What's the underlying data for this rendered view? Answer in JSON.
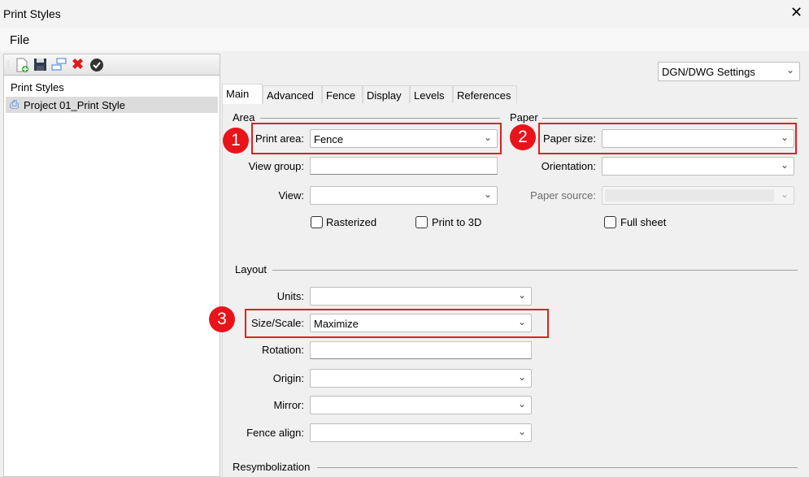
{
  "window": {
    "title": "Print Styles"
  },
  "menu": {
    "file": "File"
  },
  "toolbar": {
    "icons": [
      "new-icon",
      "save-icon",
      "copy-icon",
      "delete-icon",
      "apply-icon"
    ]
  },
  "tree": {
    "root": "Print Styles",
    "items": [
      "Project 01_Print Style"
    ]
  },
  "settings_dropdown": "DGN/DWG Settings",
  "tabs": [
    "Main",
    "Advanced",
    "Fence",
    "Display",
    "Levels",
    "References"
  ],
  "area": {
    "title": "Area",
    "print_area_label": "Print area:",
    "print_area_value": "Fence",
    "view_group_label": "View group:",
    "view_group_value": "",
    "view_label": "View:",
    "view_value": "",
    "rasterized": "Rasterized",
    "print_to_3d": "Print to 3D"
  },
  "paper": {
    "title": "Paper",
    "paper_size_label": "Paper size:",
    "paper_size_value": "",
    "orientation_label": "Orientation:",
    "orientation_value": "",
    "paper_source_label": "Paper source:",
    "full_sheet": "Full sheet"
  },
  "layout": {
    "title": "Layout",
    "units_label": "Units:",
    "units_value": "",
    "size_scale_label": "Size/Scale:",
    "size_scale_value": "Maximize",
    "rotation_label": "Rotation:",
    "rotation_value": "",
    "origin_label": "Origin:",
    "origin_value": "",
    "mirror_label": "Mirror:",
    "mirror_value": "",
    "fence_align_label": "Fence align:",
    "fence_align_value": ""
  },
  "resymbolization": {
    "title": "Resymbolization"
  },
  "annotations": [
    "1",
    "2",
    "3"
  ],
  "colors": {
    "highlight": "#e02020"
  }
}
